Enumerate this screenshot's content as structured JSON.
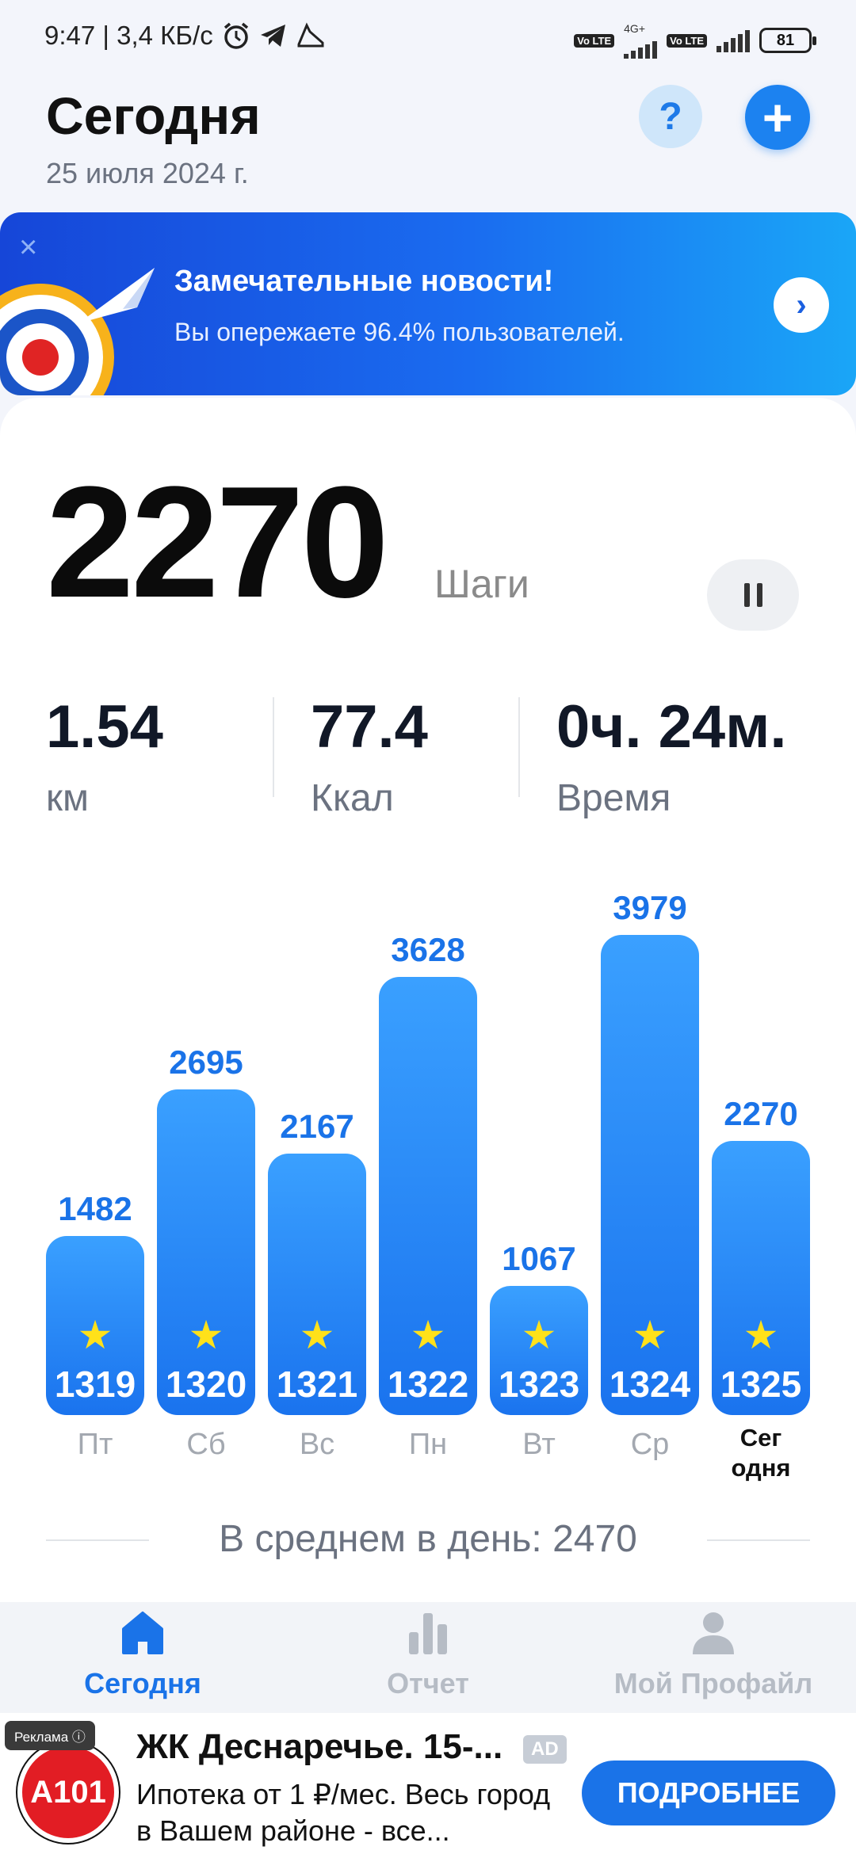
{
  "status_bar": {
    "time_speed": "9:47 | 3,4 КБ/с",
    "network_tag": "Vo LTE",
    "network_tag2": "Vo LTE",
    "net_type": "4G+",
    "battery": "81"
  },
  "header": {
    "title": "Сегодня",
    "date": "25 июля 2024 г.",
    "help_label": "?",
    "add_label": "+"
  },
  "banner": {
    "title": "Замечательные новости!",
    "subtitle": "Вы опережаете 96.4% пользователей.",
    "close": "×",
    "arrow": "›"
  },
  "summary": {
    "steps": "2270",
    "steps_unit": "Шаги",
    "distance_value": "1.54",
    "distance_unit": "км",
    "calories_value": "77.4",
    "calories_unit": "Ккал",
    "time_value": "0ч. 24м.",
    "time_unit": "Время"
  },
  "chart_data": {
    "type": "bar",
    "categories": [
      "Пт",
      "Сб",
      "Вс",
      "Пн",
      "Вт",
      "Ср",
      "Сегодня"
    ],
    "values": [
      1482,
      2695,
      2167,
      3628,
      1067,
      3979,
      2270
    ],
    "day_numbers": [
      "1319",
      "1320",
      "1321",
      "1322",
      "1323",
      "1324",
      "1325"
    ],
    "labels": [
      "Пт",
      "Сб",
      "Вс",
      "Пн",
      "Вт",
      "Ср",
      "Сег\nодня"
    ],
    "bar_color": "#1a73ee",
    "star_color": "#ffe11a"
  },
  "average": {
    "label": "В среднем в день: 2470"
  },
  "nav": {
    "today": "Сегодня",
    "report": "Отчет",
    "profile": "Мой Профайл",
    "active_color": "#1a73e8"
  },
  "ad": {
    "tag": "Реклама ⓘ",
    "logo": "A101",
    "title": "ЖК Деснаречье. 15-...",
    "badge": "AD",
    "text": "Ипотека от 1 ₽/мес. Весь город в Вашем районе - все...",
    "button": "ПОДРОБНЕЕ"
  }
}
